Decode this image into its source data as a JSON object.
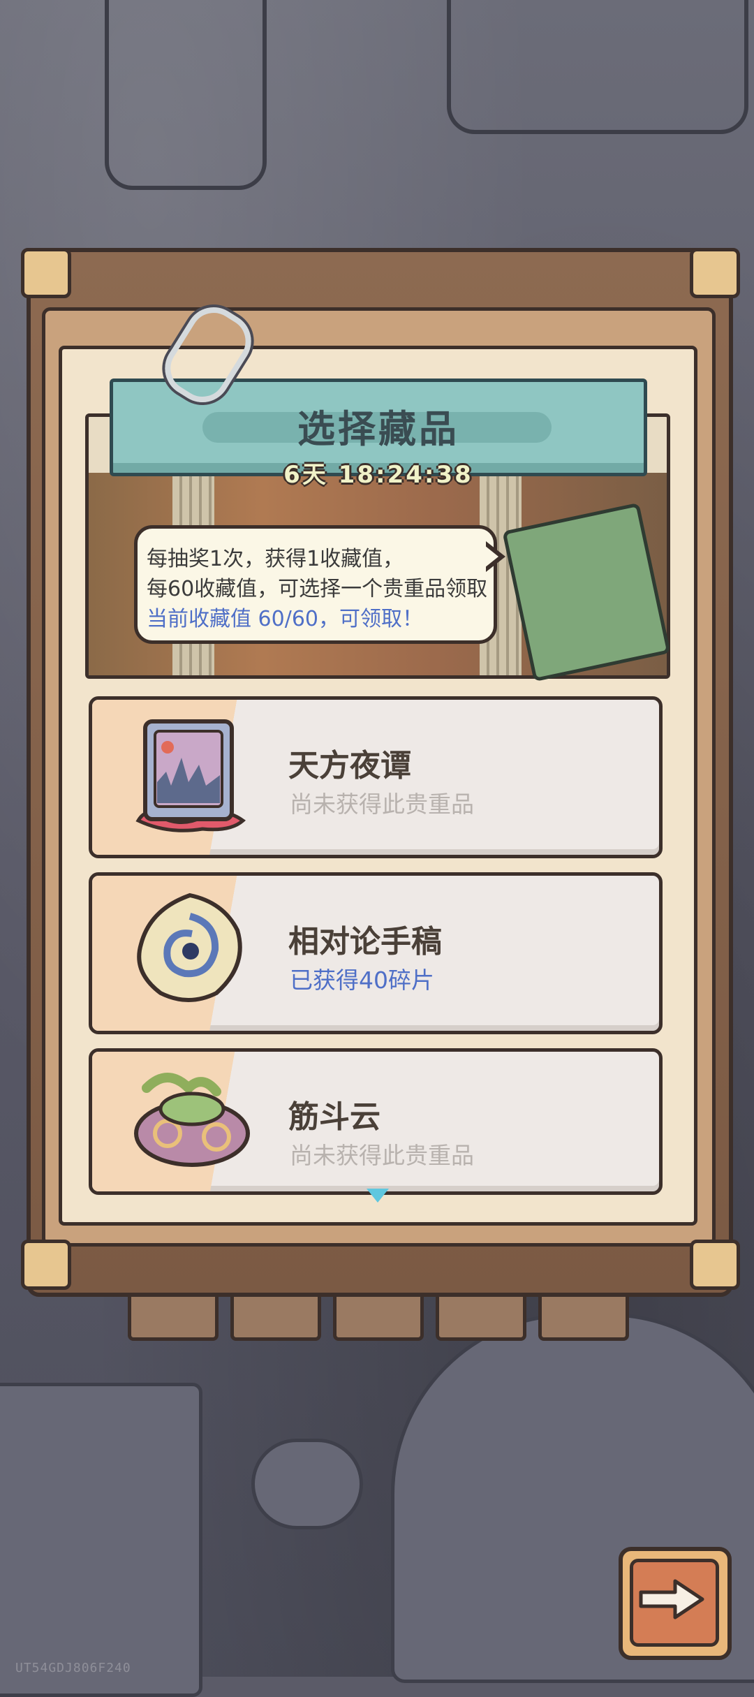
{
  "dialog": {
    "title": "选择藏品",
    "countdown": "6天 18:24:38",
    "info_line1": "每抽奖1次，获得1收藏值，",
    "info_line2": "每60收藏值，可选择一个贵重品领取",
    "info_line3": "当前收藏值 60/60，可领取！"
  },
  "collectibles": [
    {
      "name": "天方夜谭",
      "status": "尚未获得此贵重品",
      "icon": "storybook-icon",
      "obtained": false
    },
    {
      "name": "相对论手稿",
      "status": "已获得40碎片",
      "icon": "swirl-manuscript-icon",
      "obtained": true
    },
    {
      "name": "筋斗云",
      "status": "尚未获得此贵重品",
      "icon": "cloud-icon",
      "obtained": false
    }
  ],
  "footer": {
    "next_icon": "arrow-right-icon",
    "watermark": "UT54GDJ806F240"
  },
  "colors": {
    "obtained_text": "#4f6fc7",
    "not_obtained_text": "#b8b2ae",
    "banner": "#8fc6c2"
  }
}
